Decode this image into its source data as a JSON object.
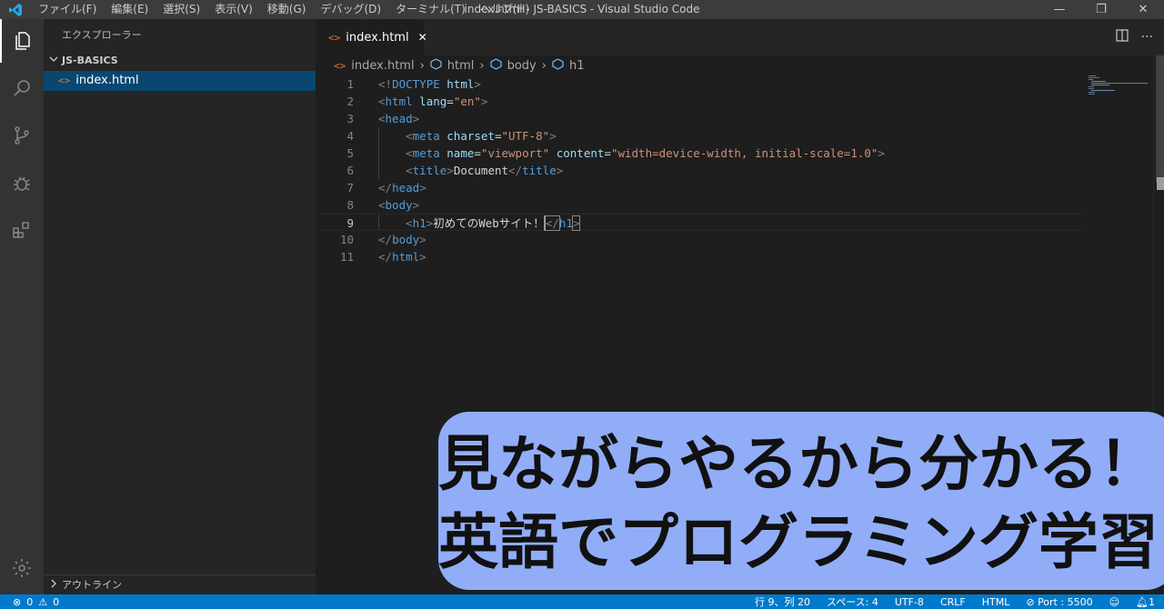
{
  "titlebar": {
    "menu": [
      "ファイル(F)",
      "編集(E)",
      "選択(S)",
      "表示(V)",
      "移動(G)",
      "デバッグ(D)",
      "ターミナル(T)",
      "ヘルプ(H)"
    ],
    "window_title": "index.html - JS-BASICS - Visual Studio Code",
    "controls": [
      "—",
      "❐",
      "✕"
    ]
  },
  "activity_bar": {
    "items": [
      "explorer-icon",
      "search-icon",
      "source-control-icon",
      "debug-icon",
      "extensions-icon",
      "gear-icon"
    ]
  },
  "sidebar": {
    "header": "エクスプローラー",
    "folder": "JS-BASICS",
    "file": "index.html",
    "outline": "アウトライン"
  },
  "tab": {
    "label": "index.html",
    "close": "✕"
  },
  "breadcrumb": [
    "index.html",
    "html",
    "body",
    "h1"
  ],
  "editor": {
    "line_numbers": [
      "1",
      "2",
      "3",
      "4",
      "5",
      "6",
      "7",
      "8",
      "9",
      "10",
      "11"
    ],
    "lines": [
      [
        [
          "b",
          "<!"
        ],
        [
          "t",
          "DOCTYPE"
        ],
        [
          "tx",
          " "
        ],
        [
          "a",
          "html"
        ],
        [
          "b",
          ">"
        ]
      ],
      [
        [
          "b",
          "<"
        ],
        [
          "t",
          "html"
        ],
        [
          "tx",
          " "
        ],
        [
          "a",
          "lang"
        ],
        [
          "tx",
          "="
        ],
        [
          "s",
          "\"en\""
        ],
        [
          "b",
          ">"
        ]
      ],
      [
        [
          "b",
          "<"
        ],
        [
          "t",
          "head"
        ],
        [
          "b",
          ">"
        ]
      ],
      [
        [
          "tx",
          "    "
        ],
        [
          "b",
          "<"
        ],
        [
          "t",
          "meta"
        ],
        [
          "tx",
          " "
        ],
        [
          "a",
          "charset"
        ],
        [
          "tx",
          "="
        ],
        [
          "s",
          "\"UTF-8\""
        ],
        [
          "b",
          ">"
        ]
      ],
      [
        [
          "tx",
          "    "
        ],
        [
          "b",
          "<"
        ],
        [
          "t",
          "meta"
        ],
        [
          "tx",
          " "
        ],
        [
          "a",
          "name"
        ],
        [
          "tx",
          "="
        ],
        [
          "s",
          "\"viewport\""
        ],
        [
          "tx",
          " "
        ],
        [
          "a",
          "content"
        ],
        [
          "tx",
          "="
        ],
        [
          "s",
          "\"width=device-width, initial-scale=1.0\""
        ],
        [
          "b",
          ">"
        ]
      ],
      [
        [
          "tx",
          "    "
        ],
        [
          "b",
          "<"
        ],
        [
          "t",
          "title"
        ],
        [
          "b",
          ">"
        ],
        [
          "tx",
          "Document"
        ],
        [
          "b",
          "</"
        ],
        [
          "t",
          "title"
        ],
        [
          "b",
          ">"
        ]
      ],
      [
        [
          "b",
          "</"
        ],
        [
          "t",
          "head"
        ],
        [
          "b",
          ">"
        ]
      ],
      [
        [
          "b",
          "<"
        ],
        [
          "t",
          "body"
        ],
        [
          "b",
          ">"
        ]
      ],
      [
        [
          "tx",
          "    "
        ],
        [
          "b",
          "<"
        ],
        [
          "t",
          "h1"
        ],
        [
          "b",
          ">"
        ],
        [
          "tx",
          "初めてのWebサイト！"
        ],
        [
          "b",
          "</"
        ],
        [
          "t",
          "h1"
        ],
        [
          "b",
          ">"
        ]
      ],
      [
        [
          "b",
          "</"
        ],
        [
          "t",
          "body"
        ],
        [
          "b",
          ">"
        ]
      ],
      [
        [
          "b",
          "</"
        ],
        [
          "t",
          "html"
        ],
        [
          "b",
          ">"
        ]
      ]
    ]
  },
  "status": {
    "errors": "0",
    "warnings": "0",
    "position": "行 9、列 20",
    "spaces": "スペース: 4",
    "encoding": "UTF-8",
    "eol": "CRLF",
    "language": "HTML",
    "port": "Port : 5500",
    "notifications": "1"
  },
  "banner": {
    "line1": "見ながらやるから分かる！",
    "line2": "英語でプログラミング学習"
  },
  "colors": {
    "accent": "#007acc",
    "banner": "#92adf8",
    "tag": "#569cd6",
    "attr": "#9cdcfe",
    "string": "#ce9178"
  }
}
